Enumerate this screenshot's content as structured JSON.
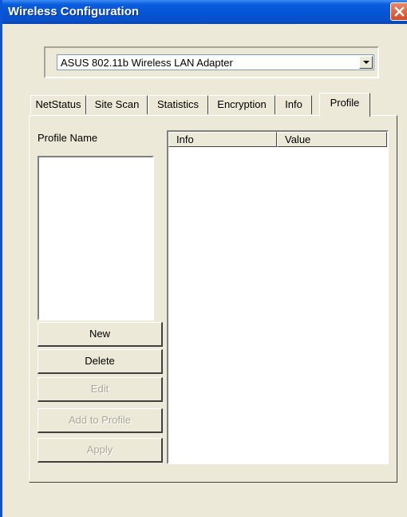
{
  "window": {
    "title": "Wireless Configuration"
  },
  "adapter": {
    "selected": "ASUS 802.11b Wireless LAN Adapter"
  },
  "tabs": [
    {
      "label": "NetStatus"
    },
    {
      "label": "Site Scan"
    },
    {
      "label": "Statistics"
    },
    {
      "label": "Encryption"
    },
    {
      "label": "Info"
    },
    {
      "label": "Profile",
      "active": true
    }
  ],
  "profile": {
    "label": "Profile Name",
    "buttons": {
      "new": "New",
      "delete": "Delete",
      "edit": "Edit",
      "add_to_profile": "Add to Profile",
      "apply": "Apply"
    },
    "table": {
      "columns": [
        "Info",
        "Value"
      ]
    }
  },
  "colors": {
    "titlebar": "#0554d6",
    "face": "#ece9d8",
    "disabled_text": "#aca899"
  }
}
